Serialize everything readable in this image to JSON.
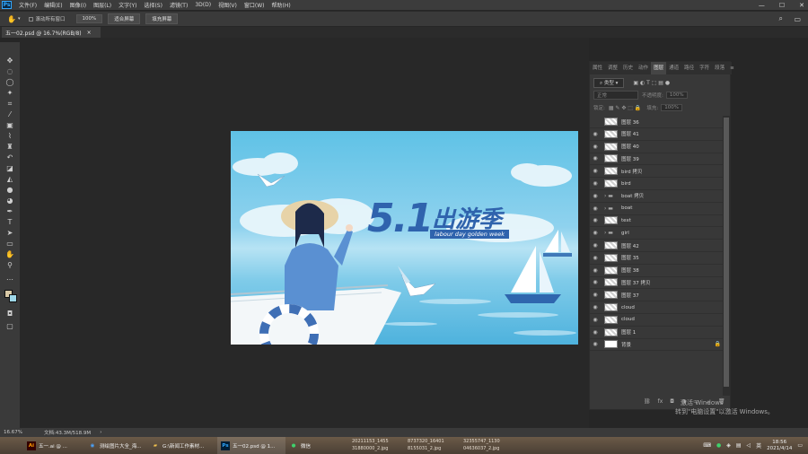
{
  "menubar": {
    "logo": "Ps",
    "items": [
      "文件(F)",
      "编辑(E)",
      "图像(I)",
      "图层(L)",
      "文字(Y)",
      "选择(S)",
      "滤镜(T)",
      "3D(D)",
      "视图(V)",
      "窗口(W)",
      "帮助(H)"
    ],
    "controls": [
      "—",
      "☐",
      "✕"
    ]
  },
  "options": {
    "scroll_all": "滚动所有窗口",
    "zoom": "100%",
    "fit_screen": "适合屏幕",
    "fill_screen": "填充屏幕"
  },
  "document_tab": {
    "title": "五一02.psd @ 16.7%(RGB/8)",
    "close": "×"
  },
  "artwork": {
    "headline_num": "5.1",
    "headline_cn": "出游季",
    "subtitle": "labour day golden week"
  },
  "panel": {
    "tabs": [
      "属性",
      "调整",
      "历史",
      "动作",
      "图层",
      "通道",
      "路径",
      "字符",
      "段落"
    ],
    "active_tab": "图层",
    "filter_kind": "类型",
    "blend_mode": "正常",
    "opacity_label": "不透明度:",
    "opacity_value": "100%",
    "lock_label": "锁定:",
    "fill_label": "填充:",
    "fill_value": "100%",
    "layers": [
      {
        "name": "图层 36",
        "type": "layer",
        "visible": false
      },
      {
        "name": "图层 41",
        "type": "layer",
        "visible": true
      },
      {
        "name": "图层 40",
        "type": "layer",
        "visible": true
      },
      {
        "name": "图层 39",
        "type": "layer",
        "visible": true
      },
      {
        "name": "bird 拷贝",
        "type": "layer",
        "visible": true
      },
      {
        "name": "bird",
        "type": "layer",
        "visible": true
      },
      {
        "name": "boat 拷贝",
        "type": "group",
        "visible": true
      },
      {
        "name": "boat",
        "type": "group",
        "visible": true
      },
      {
        "name": "text",
        "type": "layer",
        "visible": true
      },
      {
        "name": "girl",
        "type": "group",
        "visible": true
      },
      {
        "name": "图层 42",
        "type": "layer",
        "visible": true
      },
      {
        "name": "图层 35",
        "type": "layer",
        "visible": true
      },
      {
        "name": "图层 38",
        "type": "layer",
        "visible": true
      },
      {
        "name": "图层 37 拷贝",
        "type": "layer",
        "visible": true
      },
      {
        "name": "图层 37",
        "type": "layer",
        "visible": true
      },
      {
        "name": "cloud",
        "type": "layer",
        "visible": true
      },
      {
        "name": "cloud",
        "type": "layer",
        "visible": true
      },
      {
        "name": "图层 1",
        "type": "layer",
        "visible": true
      },
      {
        "name": "背景",
        "type": "background",
        "visible": true
      }
    ]
  },
  "status": {
    "zoom": "16.67%",
    "doc": "文档:43.3M/518.9M"
  },
  "watermark": {
    "line1": "激活 Windows",
    "line2": "转到\"电脑设置\"以激活 Windows。"
  },
  "taskbar": {
    "items": [
      {
        "icon": "Ai",
        "label": "五一.ai @ ..."
      },
      {
        "icon": "◉",
        "label": "测绘图片大全_海..."
      },
      {
        "icon": "▰",
        "label": "G:\\新闻工作素材..."
      },
      {
        "icon": "Ps",
        "label": "五一02.psd @ 1..."
      },
      {
        "icon": "●",
        "label": "微信"
      }
    ],
    "files": [
      "20211153_1455",
      "8737320_16401",
      "32355747_1130",
      "31880000_2.jpg",
      "8155031_2.jpg",
      "04636037_2.jpg"
    ],
    "time": "18:56",
    "date": "2021/4/14",
    "input_method": "英"
  },
  "colors": {
    "ps_blue": "#31a8ff",
    "swatch_fg": "#d9c9a6",
    "swatch_bg": "#9ed7e8"
  }
}
